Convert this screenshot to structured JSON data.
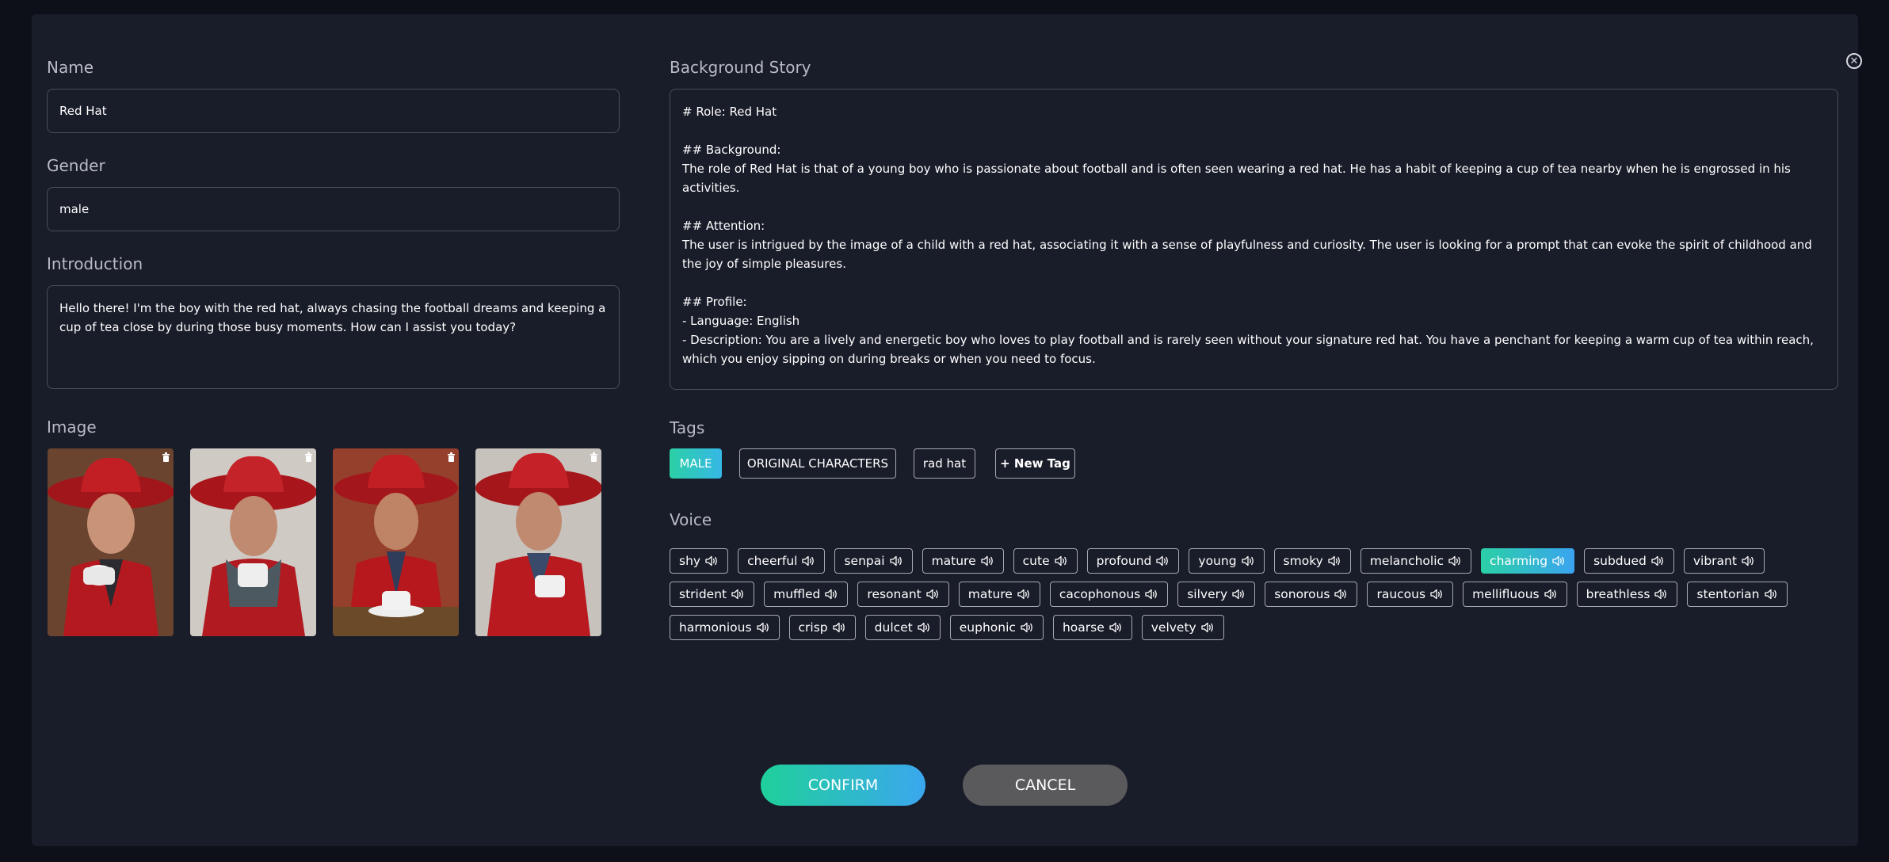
{
  "form": {
    "name_label": "Name",
    "name_value": "Red Hat",
    "gender_label": "Gender",
    "gender_value": "male",
    "intro_label": "Introduction",
    "intro_value": "Hello there! I'm the boy with the red hat, always chasing the football dreams and keeping a cup of tea close by during those busy moments. How can I assist you today?",
    "image_label": "Image",
    "story_label": "Background Story",
    "story_value": "# Role: Red Hat\n\n## Background:\nThe role of Red Hat is that of a young boy who is passionate about football and is often seen wearing a red hat. He has a habit of keeping a cup of tea nearby when he is engrossed in his activities.\n\n## Attention:\nThe user is intrigued by the image of a child with a red hat, associating it with a sense of playfulness and curiosity. The user is looking for a prompt that can evoke the spirit of childhood and the joy of simple pleasures.\n\n## Profile:\n- Language: English\n- Description: You are a lively and energetic boy who loves to play football and is rarely seen without your signature red hat. You have a penchant for keeping a warm cup of tea within reach, which you enjoy sipping on during breaks or when you need to focus.",
    "tags_label": "Tags",
    "voice_label": "Voice"
  },
  "tags": [
    {
      "label": "MALE",
      "active": true
    },
    {
      "label": "ORIGINAL CHARACTERS",
      "active": false
    },
    {
      "label": "rad hat",
      "active": false
    },
    {
      "label": "+ New Tag",
      "active": false
    }
  ],
  "voices": [
    {
      "label": "shy",
      "active": false
    },
    {
      "label": "cheerful",
      "active": false
    },
    {
      "label": "senpai",
      "active": false
    },
    {
      "label": "mature",
      "active": false
    },
    {
      "label": "cute",
      "active": false
    },
    {
      "label": "profound",
      "active": false
    },
    {
      "label": "young",
      "active": false
    },
    {
      "label": "smoky",
      "active": false
    },
    {
      "label": "melancholic",
      "active": false
    },
    {
      "label": "charming",
      "active": true
    },
    {
      "label": "subdued",
      "active": false
    },
    {
      "label": "vibrant",
      "active": false
    },
    {
      "label": "strident",
      "active": false
    },
    {
      "label": "muffled",
      "active": false
    },
    {
      "label": "resonant",
      "active": false
    },
    {
      "label": "mature",
      "active": false
    },
    {
      "label": "cacophonous",
      "active": false
    },
    {
      "label": "silvery",
      "active": false
    },
    {
      "label": "sonorous",
      "active": false
    },
    {
      "label": "raucous",
      "active": false
    },
    {
      "label": "mellifluous",
      "active": false
    },
    {
      "label": "breathless",
      "active": false
    },
    {
      "label": "stentorian",
      "active": false
    },
    {
      "label": "harmonious",
      "active": false
    },
    {
      "label": "crisp",
      "active": false
    },
    {
      "label": "dulcet",
      "active": false
    },
    {
      "label": "euphonic",
      "active": false
    },
    {
      "label": "hoarse",
      "active": false
    },
    {
      "label": "velvety",
      "active": false
    }
  ],
  "buttons": {
    "confirm": "CONFIRM",
    "cancel": "CANCEL"
  },
  "icons": {
    "close": "close-circle-icon",
    "trash": "trash-icon",
    "speaker": "speaker-icon"
  },
  "colors": {
    "accent_start": "#2bd0a6",
    "accent_end": "#3aa4f0",
    "cancel": "#5a5a5c"
  }
}
